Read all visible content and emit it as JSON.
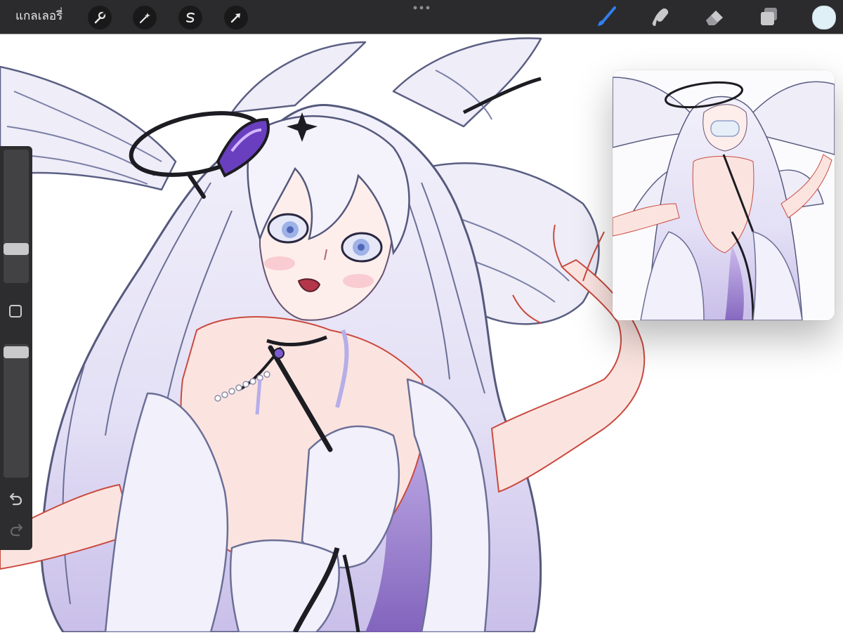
{
  "toolbar": {
    "gallery_label": "แกลเลอรี่",
    "left_tools": [
      "wrench-icon",
      "magic-wand-icon",
      "selection-icon",
      "transform-arrow-icon"
    ],
    "right_tools": [
      "brush-icon",
      "smudge-icon",
      "eraser-icon",
      "layers-icon",
      "color-icon"
    ],
    "active_tool": "brush-icon",
    "accent_color": "#2f7ff0",
    "current_color": "#dff0f7"
  },
  "sidebar": {
    "size_slider_value": 0.77,
    "opacity_slider_value": 0.0,
    "modify_button": "square-modify-icon",
    "undo": "undo-icon",
    "redo": "redo-icon"
  },
  "canvas": {
    "content": "artwork-canvas"
  },
  "reference": {
    "content": "reference-thumbnail"
  }
}
